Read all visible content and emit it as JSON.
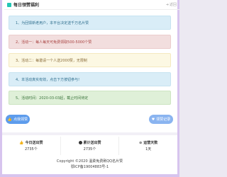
{
  "header": {
    "title": "每日领赞福利",
    "back_label": "返回"
  },
  "notices": [
    "1、为回馈新老用户，本平台决定送千万名片赞",
    "2、活动一：每人每天可免费领取500-5000个赞",
    "3、活动二：每邀请一个人送2000赞，无限制",
    "4、本活动真实有效，点击下方按钮参与!",
    "5、活动时间：2020-03-03起，截止时间待定"
  ],
  "buttons": {
    "get_label": "点我领赞",
    "log_label": "领赞记录"
  },
  "stats": [
    {
      "label": "今日送出赞",
      "value": "2735个",
      "icon": "thumb-icon"
    },
    {
      "label": "累计送出赞",
      "value": "2735个",
      "icon": "chart-icon"
    },
    {
      "label": "运营天数",
      "value": "1天",
      "icon": "clock-icon"
    }
  ],
  "footer": {
    "copyright": "Copyright ©2020  温柔免费刷QQ名片赞",
    "icp": "鄂ICP备19004883号-1"
  },
  "colors": {
    "accent": "#23c6b4",
    "primary_button": "#5d9cec",
    "frame": "#d7c4ee"
  }
}
